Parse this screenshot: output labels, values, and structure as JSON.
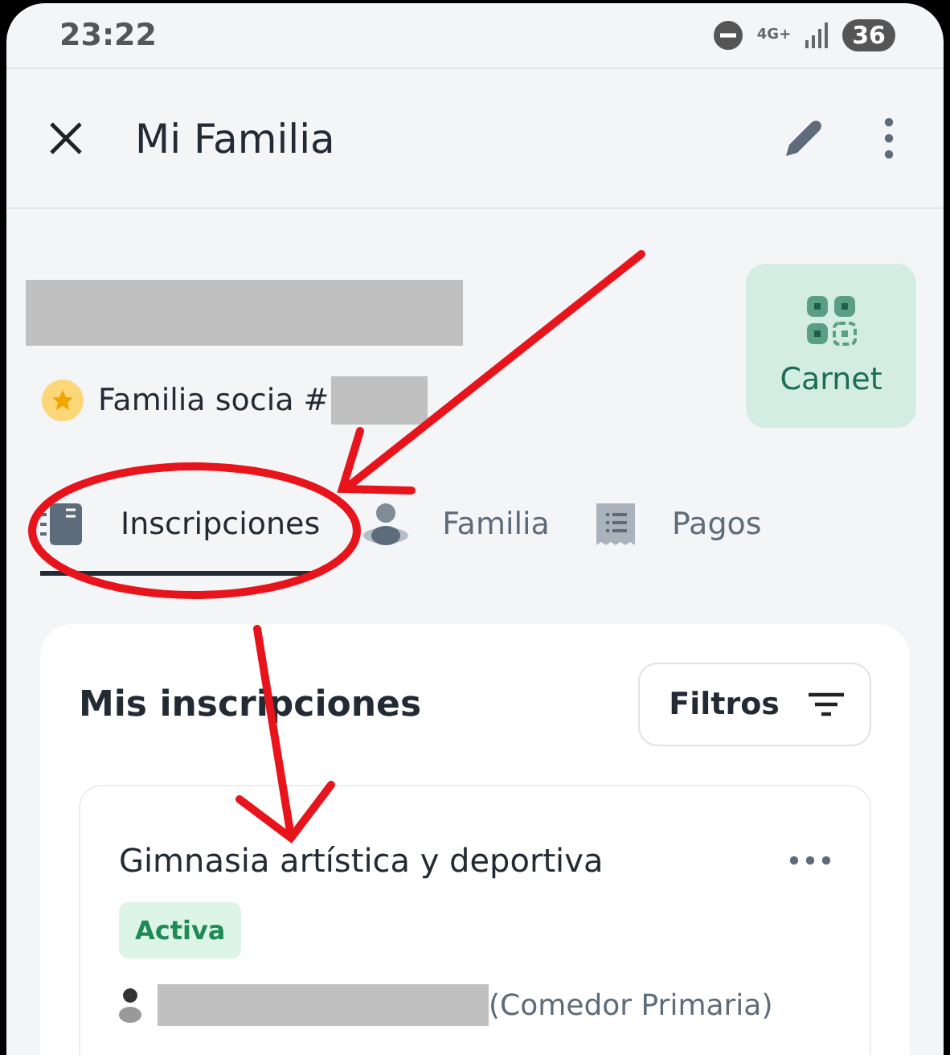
{
  "status_bar": {
    "time": "23:22",
    "network": "4G+",
    "battery": "36"
  },
  "app_bar": {
    "title": "Mi Familia"
  },
  "profile": {
    "membership": "Familia socia #",
    "card_button": "Carnet"
  },
  "tabs": [
    {
      "label": "Inscripciones",
      "selected": true
    },
    {
      "label": "Familia",
      "selected": false
    },
    {
      "label": "Pagos",
      "selected": false
    }
  ],
  "section": {
    "title": "Mis inscripciones",
    "filter_button": "Filtros"
  },
  "enrollments": [
    {
      "title": "Gimnasia artística y deportiva",
      "status": "Activa",
      "detail": "(Comedor Primaria)"
    }
  ]
}
